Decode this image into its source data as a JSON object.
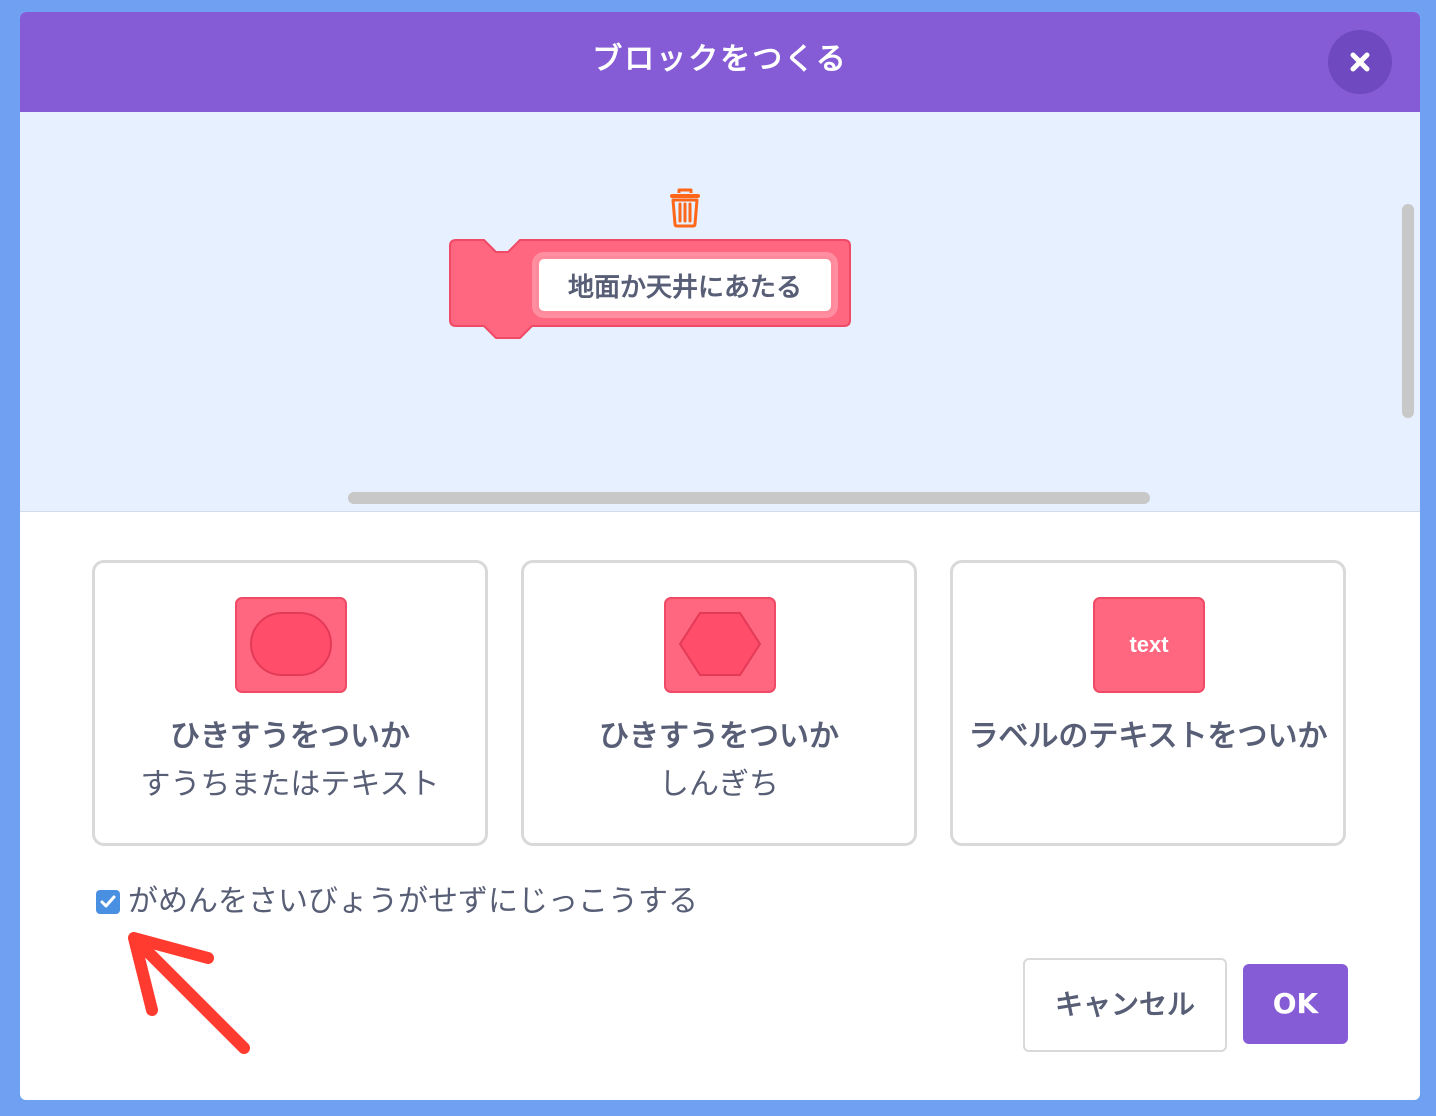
{
  "dialog": {
    "title": "ブロックをつくる",
    "close_icon": "close-icon"
  },
  "workspace": {
    "block_name": "地面か天井にあたる",
    "block_color": "#ff6680",
    "trash_icon": "trash-icon"
  },
  "options": [
    {
      "title": "ひきすうをついか",
      "subtitle": "すうちまたはテキスト",
      "icon": "round-input-icon"
    },
    {
      "title": "ひきすうをついか",
      "subtitle": "しんぎち",
      "icon": "boolean-input-icon"
    },
    {
      "title": "ラベルのテキストをついか",
      "subtitle": "",
      "icon": "label-text-icon",
      "icon_text": "text"
    }
  ],
  "run_without_refresh": {
    "label": "がめんをさいびょうがせずにじっこうする",
    "checked": true
  },
  "buttons": {
    "cancel": "キャンセル",
    "ok": "OK"
  },
  "colors": {
    "header": "#855cd6",
    "accent_block": "#ff6680",
    "annotation_arrow": "#ff3b30",
    "checkbox": "#4a90e2"
  }
}
